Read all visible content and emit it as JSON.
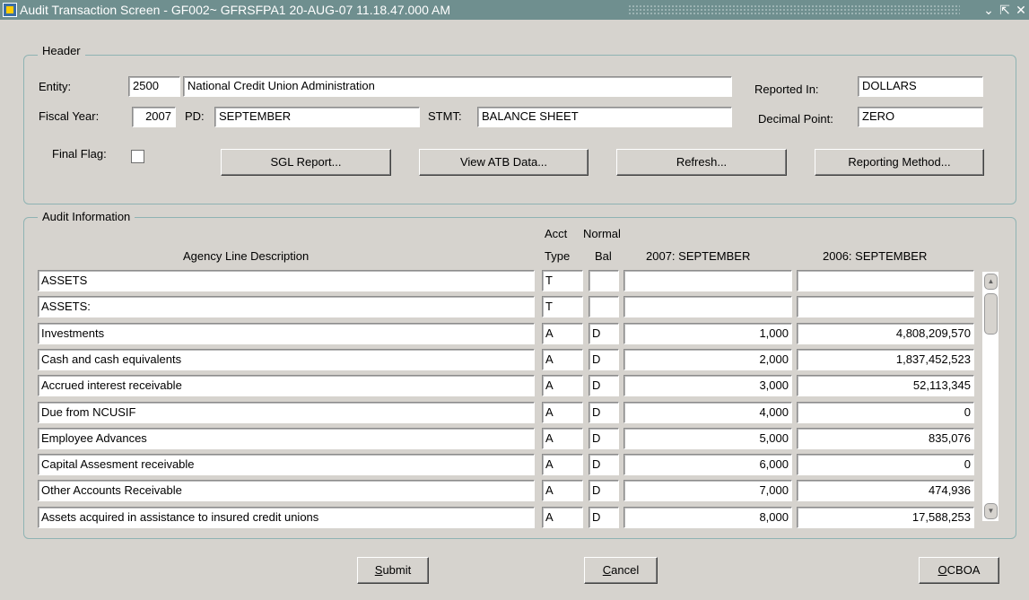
{
  "window": {
    "title": "Audit Transaction Screen - GF002~ GFRSFPA1  20-AUG-07 11.18.47.000 AM",
    "controls": {
      "minimize": "⌄",
      "maximize": "⇱",
      "close": "✕"
    }
  },
  "header": {
    "legend": "Header",
    "entity_label": "Entity:",
    "entity_code": "2500",
    "entity_name": "National Credit Union Administration",
    "reported_in_label": "Reported In:",
    "reported_in_value": "DOLLARS",
    "fiscal_year_label": "Fiscal Year:",
    "fiscal_year_value": "2007",
    "pd_label": "PD:",
    "pd_value": "SEPTEMBER",
    "stmt_label": "STMT:",
    "stmt_value": "BALANCE SHEET",
    "decimal_point_label": "Decimal Point:",
    "decimal_point_value": "ZERO",
    "final_flag_label": "Final Flag:",
    "final_flag_checked": false,
    "buttons": {
      "sgl_report": "SGL Report...",
      "view_atb": "View ATB Data...",
      "refresh": "Refresh...",
      "reporting_method": "Reporting Method..."
    }
  },
  "audit": {
    "legend": "Audit Information",
    "columns": {
      "description": "Agency Line Description",
      "acct_top": "Acct",
      "acct_bottom": "Type",
      "normal_top": "Normal",
      "normal_bottom": "Bal",
      "current": "2007: SEPTEMBER",
      "prior": "2006: SEPTEMBER"
    },
    "rows": [
      {
        "description": "ASSETS",
        "type": "T",
        "bal": "",
        "current": "",
        "prior": ""
      },
      {
        "description": "ASSETS:",
        "type": "T",
        "bal": "",
        "current": "",
        "prior": ""
      },
      {
        "description": "Investments",
        "type": "A",
        "bal": "D",
        "current": "1,000",
        "prior": "4,808,209,570"
      },
      {
        "description": "Cash and cash equivalents",
        "type": "A",
        "bal": "D",
        "current": "2,000",
        "prior": "1,837,452,523"
      },
      {
        "description": "Accrued interest receivable",
        "type": "A",
        "bal": "D",
        "current": "3,000",
        "prior": "52,113,345"
      },
      {
        "description": "Due from NCUSIF",
        "type": "A",
        "bal": "D",
        "current": "4,000",
        "prior": "0"
      },
      {
        "description": "Employee Advances",
        "type": "A",
        "bal": "D",
        "current": "5,000",
        "prior": "835,076"
      },
      {
        "description": "Capital Assesment receivable",
        "type": "A",
        "bal": "D",
        "current": "6,000",
        "prior": "0"
      },
      {
        "description": "Other Accounts Receivable",
        "type": "A",
        "bal": "D",
        "current": "7,000",
        "prior": "474,936"
      },
      {
        "description": "Assets acquired in assistance to insured credit unions",
        "type": "A",
        "bal": "D",
        "current": "8,000",
        "prior": "17,588,253"
      }
    ]
  },
  "footer": {
    "submit_first": "S",
    "submit_rest": "ubmit",
    "cancel_first": "C",
    "cancel_rest": "ancel",
    "ocboa_first": "O",
    "ocboa_rest": "CBOA"
  }
}
